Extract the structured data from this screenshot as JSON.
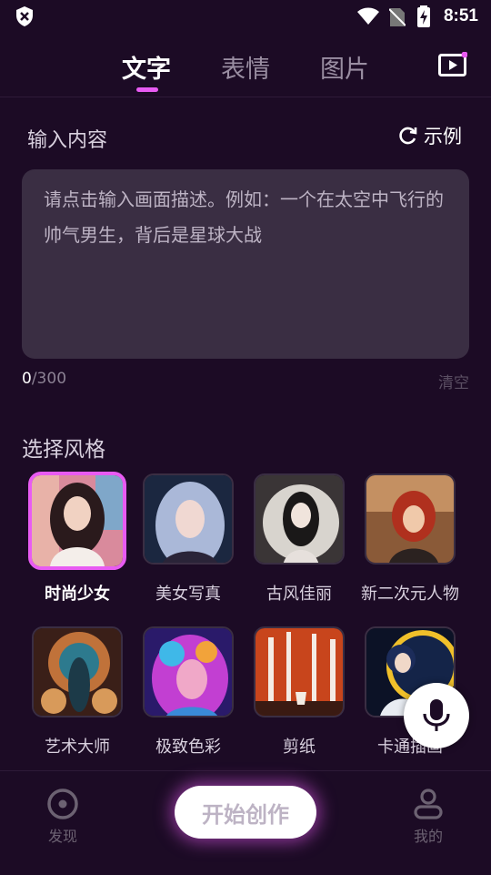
{
  "status_bar": {
    "time": "8:51"
  },
  "tabs": [
    {
      "label": "文字",
      "active": true
    },
    {
      "label": "表情",
      "active": false
    },
    {
      "label": "图片",
      "active": false
    }
  ],
  "input_section": {
    "title": "输入内容",
    "example_label": "示例",
    "placeholder": "请点击输入画面描述。例如：一个在太空中飞行的帅气男生，背后是星球大战",
    "count_current": "0",
    "count_max": "/300",
    "clear_label": "清空"
  },
  "style_section": {
    "title": "选择风格",
    "items": [
      {
        "label": "时尚少女",
        "selected": true
      },
      {
        "label": "美女写真",
        "selected": false
      },
      {
        "label": "古风佳丽",
        "selected": false
      },
      {
        "label": "新二次元人物",
        "selected": false
      },
      {
        "label": "艺术大师",
        "selected": false
      },
      {
        "label": "极致色彩",
        "selected": false
      },
      {
        "label": "剪纸",
        "selected": false
      },
      {
        "label": "卡通插画",
        "selected": false
      }
    ]
  },
  "bottom_nav": {
    "discover_label": "发现",
    "create_label": "开始创作",
    "mine_label": "我的"
  },
  "colors": {
    "accent": "#e85bf2",
    "background": "#1c0b25",
    "input_bg": "#3a2e43"
  }
}
